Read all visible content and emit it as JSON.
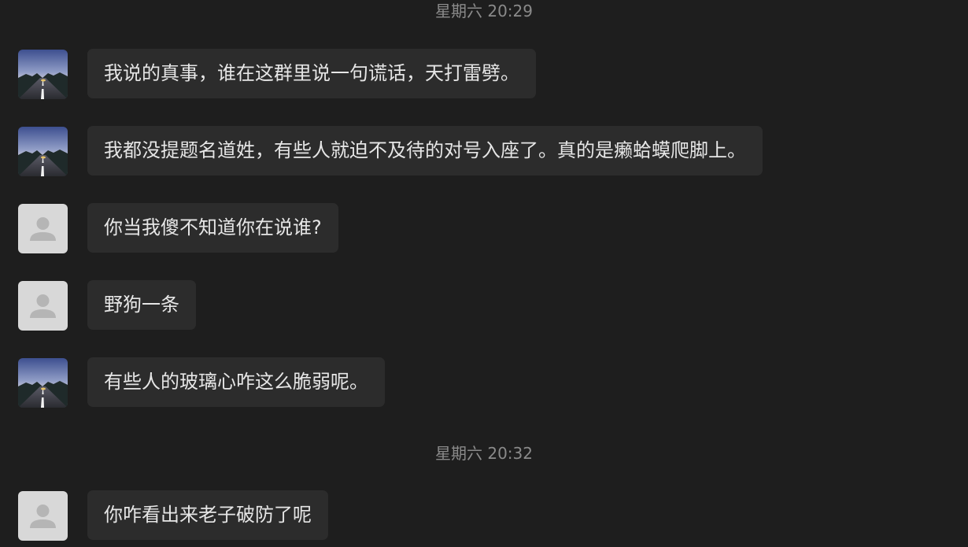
{
  "chat": {
    "groups": [
      {
        "timestamp": "星期六 20:29",
        "messages": [
          {
            "avatar": "road-photo-avatar",
            "text": "我说的真事，谁在这群里说一句谎话，天打雷劈。"
          },
          {
            "avatar": "road-photo-avatar",
            "text": "我都没提题名道姓，有些人就迫不及待的对号入座了。真的是癞蛤蟆爬脚上。"
          },
          {
            "avatar": "default-user-avatar",
            "text": "你当我傻不知道你在说谁?"
          },
          {
            "avatar": "default-user-avatar",
            "text": "野狗一条"
          },
          {
            "avatar": "road-photo-avatar",
            "text": "有些人的玻璃心咋这么脆弱呢。"
          }
        ]
      },
      {
        "timestamp": "星期六 20:32",
        "messages": [
          {
            "avatar": "default-user-avatar",
            "text": "你咋看出来老子破防了呢"
          }
        ]
      }
    ]
  },
  "colors": {
    "background": "#1e1e1e",
    "bubble": "#2c2c2c",
    "message_text": "#e6e6e6",
    "timestamp_text": "#8a8a8a",
    "default_avatar_bg": "#d8d8d8",
    "default_avatar_figure": "#b5b5b5"
  }
}
